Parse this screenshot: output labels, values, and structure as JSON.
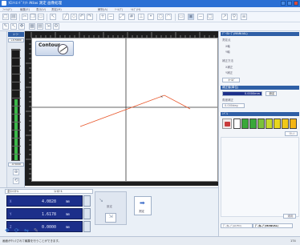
{
  "window": {
    "title": "ﾌﾛﾝﾄｴﾝﾄﾞｿﾌﾄ Atlas 測定 画像処理"
  },
  "menubar": {
    "items": [
      "ﾌｧｲﾙ(F)",
      "編集(E)",
      "表示(V)",
      "測定(M)",
      "解析(A)",
      "ﾂｰﾙ(T)",
      "ﾍﾙﾌﾟ(H)"
    ]
  },
  "toolbar": {
    "icons": [
      "open-icon",
      "save-icon",
      "cut-icon",
      "copy-icon",
      "paste-icon",
      "undo-icon",
      "redo-icon",
      "cursor-icon",
      "line-icon",
      "shape-icon",
      "zoom-icon",
      "fit-icon",
      "grid-icon"
    ]
  },
  "ruler_panel": {
    "title": "ﾙｰﾗｰ",
    "top_value": "+0.5000",
    "bottom_value": "-0.5000",
    "fill_fraction": 0.55
  },
  "canvas": {
    "title": "Contour"
  },
  "right_panel": {
    "header": "ﾃﾞｰﾀﾙｰﾌﾟ(MANUAL)",
    "labels": [
      "測定点",
      "X軸",
      "Y軸",
      "補正方法",
      "X補正",
      "Y補正"
    ],
    "button_label": "ﾎｰﾙﾄﾞ",
    "field_label": "補正値(単位)",
    "field_value": "0.0000mm",
    "field_unit": "設定",
    "sub_label": "角度補正",
    "sub_value": "0.000deg",
    "level_label": "ﾚﾍﾞﾙ",
    "bar_colors": [
      "#ffffff",
      "#3aa83a",
      "#3aa83a",
      "#7bc23a",
      "#c6d92c",
      "#e8d61e",
      "#f0c818",
      "#f4b515"
    ],
    "reset_label": "ﾘｾｯﾄ",
    "bottom_btn": "適用",
    "footer_tabs": [
      "ﾃﾞｰﾀﾙｰﾌﾟ(AUTO)",
      "ﾃﾞｰﾀﾙｰﾌﾟ(MANUAL)"
    ]
  },
  "bottom_panel": {
    "selector": "全ｺﾝﾄﾛｰﾙ",
    "selector2": "ｺﾝﾄﾛｰﾙ",
    "dro": [
      {
        "axis": "X",
        "value": "4.0828",
        "unit": "mm"
      },
      {
        "axis": "Y",
        "value": "1.6178",
        "unit": "mm"
      },
      {
        "axis": "Z",
        "value": "0.0000",
        "unit": "mm"
      }
    ],
    "mid_button": "設定",
    "mid_icon": "record-icon",
    "big_button": "測定"
  },
  "status_bar": {
    "text": "画面がｸﾘｯｸされて編集を行うことができます。",
    "right": "174"
  }
}
